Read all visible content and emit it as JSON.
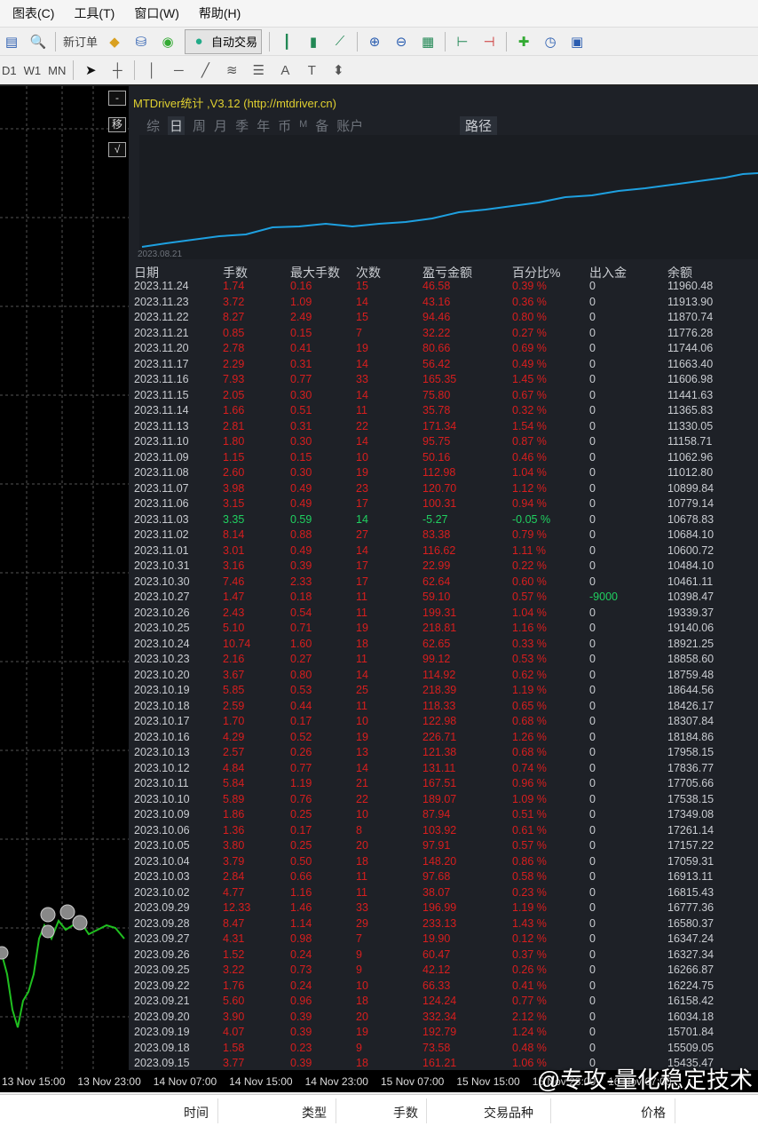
{
  "menu": [
    "图表(C)",
    "工具(T)",
    "窗口(W)",
    "帮助(H)"
  ],
  "toolbar": {
    "new_order": "新订单",
    "auto_trade": "自动交易"
  },
  "timeframes": [
    "D1",
    "W1",
    "MN"
  ],
  "panel": {
    "title": "MTDriver统计 ,V3.12 (http://mtdriver.cn)",
    "tabs": [
      "综",
      "日",
      "周",
      "月",
      "季",
      "年",
      "币",
      "M",
      "备",
      "账户"
    ],
    "active_tab": "日",
    "route": "路径",
    "equity_start_label": "2023.08.21",
    "side_buttons": [
      "-",
      "移",
      "√"
    ]
  },
  "table": {
    "headers": [
      "日期",
      "手数",
      "最大手数",
      "次数",
      "盈亏金额",
      "百分比%",
      "出入金",
      "余额"
    ],
    "rows": [
      [
        "2023.11.24",
        "1.74",
        "0.16",
        "15",
        "46.58",
        "0.39 %",
        "0",
        "11960.48"
      ],
      [
        "2023.11.23",
        "3.72",
        "1.09",
        "14",
        "43.16",
        "0.36 %",
        "0",
        "11913.90"
      ],
      [
        "2023.11.22",
        "8.27",
        "2.49",
        "15",
        "94.46",
        "0.80 %",
        "0",
        "11870.74"
      ],
      [
        "2023.11.21",
        "0.85",
        "0.15",
        "7",
        "32.22",
        "0.27 %",
        "0",
        "11776.28"
      ],
      [
        "2023.11.20",
        "2.78",
        "0.41",
        "19",
        "80.66",
        "0.69 %",
        "0",
        "11744.06"
      ],
      [
        "2023.11.17",
        "2.29",
        "0.31",
        "14",
        "56.42",
        "0.49 %",
        "0",
        "11663.40"
      ],
      [
        "2023.11.16",
        "7.93",
        "0.77",
        "33",
        "165.35",
        "1.45 %",
        "0",
        "11606.98"
      ],
      [
        "2023.11.15",
        "2.05",
        "0.30",
        "14",
        "75.80",
        "0.67 %",
        "0",
        "11441.63"
      ],
      [
        "2023.11.14",
        "1.66",
        "0.51",
        "11",
        "35.78",
        "0.32 %",
        "0",
        "11365.83"
      ],
      [
        "2023.11.13",
        "2.81",
        "0.31",
        "22",
        "171.34",
        "1.54 %",
        "0",
        "11330.05"
      ],
      [
        "2023.11.10",
        "1.80",
        "0.30",
        "14",
        "95.75",
        "0.87 %",
        "0",
        "11158.71"
      ],
      [
        "2023.11.09",
        "1.15",
        "0.15",
        "10",
        "50.16",
        "0.46 %",
        "0",
        "11062.96"
      ],
      [
        "2023.11.08",
        "2.60",
        "0.30",
        "19",
        "112.98",
        "1.04 %",
        "0",
        "11012.80"
      ],
      [
        "2023.11.07",
        "3.98",
        "0.49",
        "23",
        "120.70",
        "1.12 %",
        "0",
        "10899.84"
      ],
      [
        "2023.11.06",
        "3.15",
        "0.49",
        "17",
        "100.31",
        "0.94 %",
        "0",
        "10779.14"
      ],
      [
        "2023.11.03",
        "3.35",
        "0.59",
        "14",
        "-5.27",
        "-0.05 %",
        "0",
        "10678.83"
      ],
      [
        "2023.11.02",
        "8.14",
        "0.88",
        "27",
        "83.38",
        "0.79 %",
        "0",
        "10684.10"
      ],
      [
        "2023.11.01",
        "3.01",
        "0.49",
        "14",
        "116.62",
        "1.11 %",
        "0",
        "10600.72"
      ],
      [
        "2023.10.31",
        "3.16",
        "0.39",
        "17",
        "22.99",
        "0.22 %",
        "0",
        "10484.10"
      ],
      [
        "2023.10.30",
        "7.46",
        "2.33",
        "17",
        "62.64",
        "0.60 %",
        "0",
        "10461.11"
      ],
      [
        "2023.10.27",
        "1.47",
        "0.18",
        "11",
        "59.10",
        "0.57 %",
        "-9000",
        "10398.47"
      ],
      [
        "2023.10.26",
        "2.43",
        "0.54",
        "11",
        "199.31",
        "1.04 %",
        "0",
        "19339.37"
      ],
      [
        "2023.10.25",
        "5.10",
        "0.71",
        "19",
        "218.81",
        "1.16 %",
        "0",
        "19140.06"
      ],
      [
        "2023.10.24",
        "10.74",
        "1.60",
        "18",
        "62.65",
        "0.33 %",
        "0",
        "18921.25"
      ],
      [
        "2023.10.23",
        "2.16",
        "0.27",
        "11",
        "99.12",
        "0.53 %",
        "0",
        "18858.60"
      ],
      [
        "2023.10.20",
        "3.67",
        "0.80",
        "14",
        "114.92",
        "0.62 %",
        "0",
        "18759.48"
      ],
      [
        "2023.10.19",
        "5.85",
        "0.53",
        "25",
        "218.39",
        "1.19 %",
        "0",
        "18644.56"
      ],
      [
        "2023.10.18",
        "2.59",
        "0.44",
        "11",
        "118.33",
        "0.65 %",
        "0",
        "18426.17"
      ],
      [
        "2023.10.17",
        "1.70",
        "0.17",
        "10",
        "122.98",
        "0.68 %",
        "0",
        "18307.84"
      ],
      [
        "2023.10.16",
        "4.29",
        "0.52",
        "19",
        "226.71",
        "1.26 %",
        "0",
        "18184.86"
      ],
      [
        "2023.10.13",
        "2.57",
        "0.26",
        "13",
        "121.38",
        "0.68 %",
        "0",
        "17958.15"
      ],
      [
        "2023.10.12",
        "4.84",
        "0.77",
        "14",
        "131.11",
        "0.74 %",
        "0",
        "17836.77"
      ],
      [
        "2023.10.11",
        "5.84",
        "1.19",
        "21",
        "167.51",
        "0.96 %",
        "0",
        "17705.66"
      ],
      [
        "2023.10.10",
        "5.89",
        "0.76",
        "22",
        "189.07",
        "1.09 %",
        "0",
        "17538.15"
      ],
      [
        "2023.10.09",
        "1.86",
        "0.25",
        "10",
        "87.94",
        "0.51 %",
        "0",
        "17349.08"
      ],
      [
        "2023.10.06",
        "1.36",
        "0.17",
        "8",
        "103.92",
        "0.61 %",
        "0",
        "17261.14"
      ],
      [
        "2023.10.05",
        "3.80",
        "0.25",
        "20",
        "97.91",
        "0.57 %",
        "0",
        "17157.22"
      ],
      [
        "2023.10.04",
        "3.79",
        "0.50",
        "18",
        "148.20",
        "0.86 %",
        "0",
        "17059.31"
      ],
      [
        "2023.10.03",
        "2.84",
        "0.66",
        "11",
        "97.68",
        "0.58 %",
        "0",
        "16913.11"
      ],
      [
        "2023.10.02",
        "4.77",
        "1.16",
        "11",
        "38.07",
        "0.23 %",
        "0",
        "16815.43"
      ],
      [
        "2023.09.29",
        "12.33",
        "1.46",
        "33",
        "196.99",
        "1.19 %",
        "0",
        "16777.36"
      ],
      [
        "2023.09.28",
        "8.47",
        "1.14",
        "29",
        "233.13",
        "1.43 %",
        "0",
        "16580.37"
      ],
      [
        "2023.09.27",
        "4.31",
        "0.98",
        "7",
        "19.90",
        "0.12 %",
        "0",
        "16347.24"
      ],
      [
        "2023.09.26",
        "1.52",
        "0.24",
        "9",
        "60.47",
        "0.37 %",
        "0",
        "16327.34"
      ],
      [
        "2023.09.25",
        "3.22",
        "0.73",
        "9",
        "42.12",
        "0.26 %",
        "0",
        "16266.87"
      ],
      [
        "2023.09.22",
        "1.76",
        "0.24",
        "10",
        "66.33",
        "0.41 %",
        "0",
        "16224.75"
      ],
      [
        "2023.09.21",
        "5.60",
        "0.96",
        "18",
        "124.24",
        "0.77 %",
        "0",
        "16158.42"
      ],
      [
        "2023.09.20",
        "3.90",
        "0.39",
        "20",
        "332.34",
        "2.12 %",
        "0",
        "16034.18"
      ],
      [
        "2023.09.19",
        "4.07",
        "0.39",
        "19",
        "192.79",
        "1.24 %",
        "0",
        "15701.84"
      ],
      [
        "2023.09.18",
        "1.58",
        "0.23",
        "9",
        "73.58",
        "0.48 %",
        "0",
        "15509.05"
      ],
      [
        "2023.09.15",
        "3.77",
        "0.39",
        "18",
        "161.21",
        "1.06 %",
        "0",
        "15435.47"
      ]
    ]
  },
  "time_axis": [
    "13 Nov 15:00",
    "13 Nov 23:00",
    "14 Nov 07:00",
    "14 Nov 15:00",
    "14 Nov 23:00",
    "15 Nov 07:00",
    "15 Nov 15:00",
    "15 Nov 23:00",
    "16 Nov 07:00"
  ],
  "watermark": "@专攻-量化稳定技术",
  "bottom_headers": [
    "时间",
    "类型",
    "手数",
    "交易品种",
    "价格"
  ],
  "colors": {
    "profit": "#d81e1e",
    "loss": "#20d060",
    "title": "#e0d030",
    "equity_line": "#1ea0e0"
  }
}
